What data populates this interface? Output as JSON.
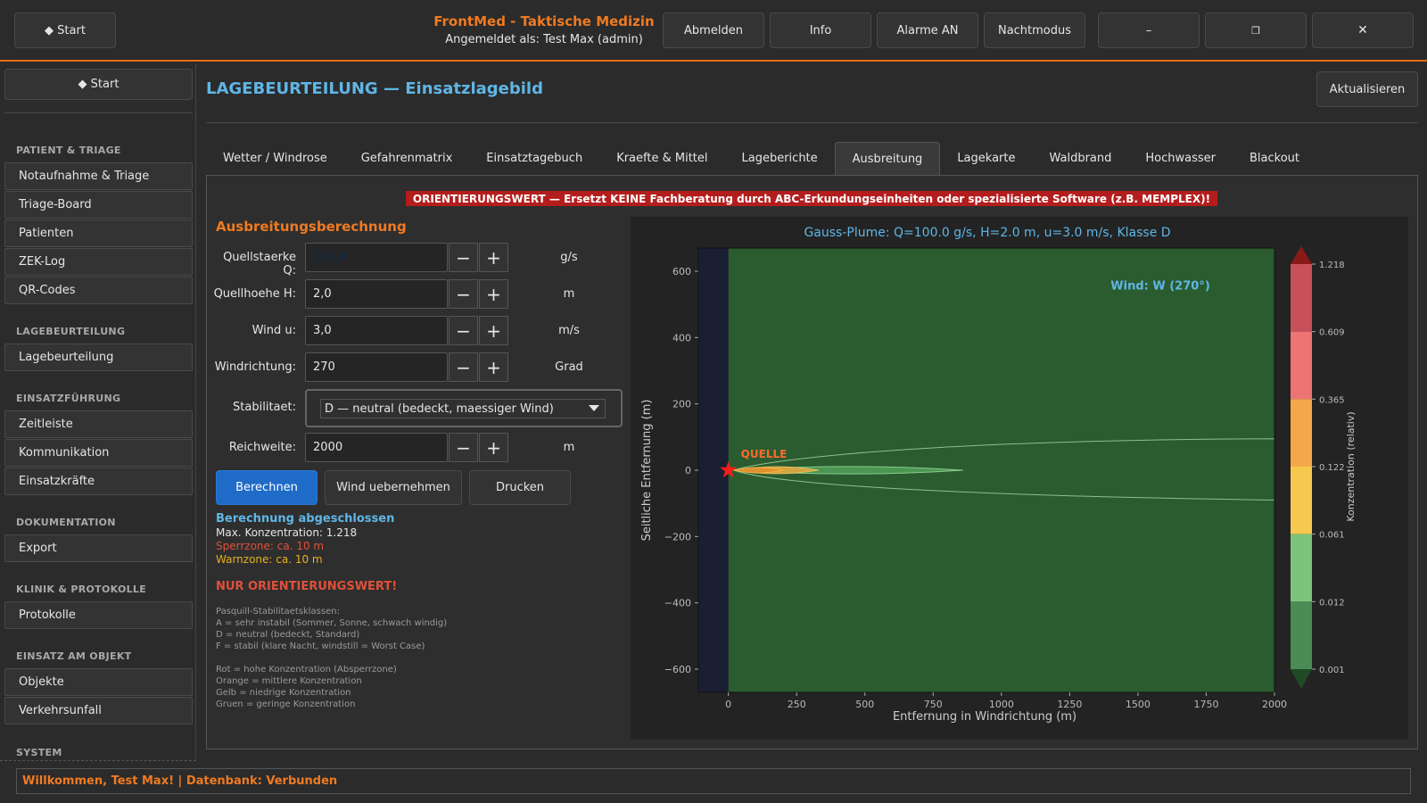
{
  "topbar": {
    "start_label": "◆  Start",
    "title": "FrontMed - Taktische Medizin",
    "user": "Angemeldet als: Test Max (admin)",
    "buttons": [
      "Abmelden",
      "Info",
      "Alarme AN",
      "Nachtmodus"
    ],
    "minimize": "–",
    "maximize": "❐",
    "close": "✕"
  },
  "sidebar": {
    "start_label": "◆  Start",
    "sections": [
      {
        "title": "PATIENT & TRIAGE",
        "items": [
          "Notaufnahme & Triage",
          "Triage-Board",
          "Patienten",
          "ZEK-Log",
          "QR-Codes"
        ]
      },
      {
        "title": "LAGEBEURTEILUNG",
        "items": [
          "Lagebeurteilung"
        ]
      },
      {
        "title": "EINSATZFÜHRUNG",
        "items": [
          "Zeitleiste",
          "Kommunikation",
          "Einsatzkräfte"
        ]
      },
      {
        "title": "DOKUMENTATION",
        "items": [
          "Export"
        ]
      },
      {
        "title": "KLINIK & PROTOKOLLE",
        "items": [
          "Protokolle"
        ]
      },
      {
        "title": "EINSATZ AM OBJEKT",
        "items": [
          "Objekte",
          "Verkehrsunfall"
        ]
      },
      {
        "title": "SYSTEM",
        "items": []
      }
    ]
  },
  "main": {
    "title": "LAGEBEURTEILUNG — Einsatzlagebild",
    "refresh_label": "Aktualisieren",
    "tabs": [
      "Wetter / Windrose",
      "Gefahrenmatrix",
      "Einsatztagebuch",
      "Kraefte & Mittel",
      "Lageberichte",
      "Ausbreitung",
      "Lagekarte",
      "Waldbrand",
      "Hochwasser",
      "Blackout"
    ],
    "active_tab": "Ausbreitung",
    "warning": "ORIENTIERUNGSWERT — Ersetzt KEINE Fachberatung durch ABC-Erkundungseinheiten oder spezialisierte Software (z.B. MEMPLEX)!"
  },
  "form": {
    "heading": "Ausbreitungsberechnung",
    "fields": [
      {
        "label": "Quellstaerke Q:",
        "value": "100,0",
        "unit": "g/s"
      },
      {
        "label": "Quellhoehe H:",
        "value": "2,0",
        "unit": "m"
      },
      {
        "label": "Wind u:",
        "value": "3,0",
        "unit": "m/s"
      },
      {
        "label": "Windrichtung:",
        "value": "270",
        "unit": "Grad"
      },
      {
        "label": "Reichweite:",
        "value": "2000",
        "unit": "m"
      }
    ],
    "stability_label": "Stabilitaet:",
    "stability_value": "D — neutral (bedeckt, maessiger Wind)",
    "buttons": {
      "calc": "Berechnen",
      "wind": "Wind uebernehmen",
      "print": "Drucken"
    },
    "step_minus": "−",
    "step_plus": "+"
  },
  "results": {
    "status": "Berechnung abgeschlossen",
    "max": "Max. Konzentration: 1.218",
    "block": "Sperrzone: ca. 10 m",
    "warn": "Warnzone: ca. 10 m",
    "note": "NUR ORIENTIERUNGSWERT!",
    "legend": [
      "Pasquill-Stabilitaetsklassen:",
      "A = sehr instabil (Sommer, Sonne, schwach windig)",
      "D = neutral (bedeckt, Standard)",
      "F = stabil (klare Nacht, windstill = Worst Case)",
      "",
      "Rot = hohe Konzentration (Absperrzone)",
      "Orange = mittlere Konzentration",
      "Gelb = niedrige Konzentration",
      "Gruen = geringe Konzentration"
    ]
  },
  "chart_data": {
    "type": "heatmap",
    "title": "Gauss-Plume: Q=100.0 g/s, H=2.0 m, u=3.0 m/s, Klasse D",
    "xlabel": "Entfernung in Windrichtung (m)",
    "ylabel": "Seitliche Entfernung (m)",
    "colorbar_label": "Konzentration (relativ)",
    "xlim": [
      -110,
      2000
    ],
    "ylim": [
      -670,
      670
    ],
    "x_ticks": [
      0,
      250,
      500,
      750,
      1000,
      1250,
      1500,
      1750,
      2000
    ],
    "y_ticks": [
      600,
      400,
      200,
      0,
      -200,
      -400,
      -600
    ],
    "x_tick_labels": [
      "0",
      "250",
      "500",
      "750",
      "1000",
      "1250",
      "1500",
      "1750",
      "2000"
    ],
    "y_tick_labels": [
      "600",
      "400",
      "200",
      "0",
      "−200",
      "−400",
      "−600"
    ],
    "levels": [
      "1.218",
      "0.609",
      "0.365",
      "0.122",
      "0.061",
      "0.012",
      "0.001"
    ],
    "level_values": [
      1.218,
      0.609,
      0.365,
      0.122,
      0.061,
      0.012,
      0.001
    ],
    "level_colors": [
      "#c8505a",
      "#ee7474",
      "#f4a84a",
      "#f6c84e",
      "#7cc47c",
      "#4a8c54"
    ],
    "source": {
      "x": 0,
      "y": 0,
      "label": "QUELLE"
    },
    "wind_label": "Wind: W (270°)",
    "contours": [
      {
        "level": 0.001,
        "x_end": 2000,
        "half_width_end": 110
      },
      {
        "level": 0.012,
        "x_end": 860,
        "half_width_end": 14
      },
      {
        "level": 0.122,
        "x_end": 330,
        "half_width_end": 13
      },
      {
        "level": 0.365,
        "x_end": 200,
        "half_width_end": 10
      }
    ]
  },
  "statusbar": {
    "text": "Willkommen, Test Max! | Datenbank: Verbunden"
  }
}
